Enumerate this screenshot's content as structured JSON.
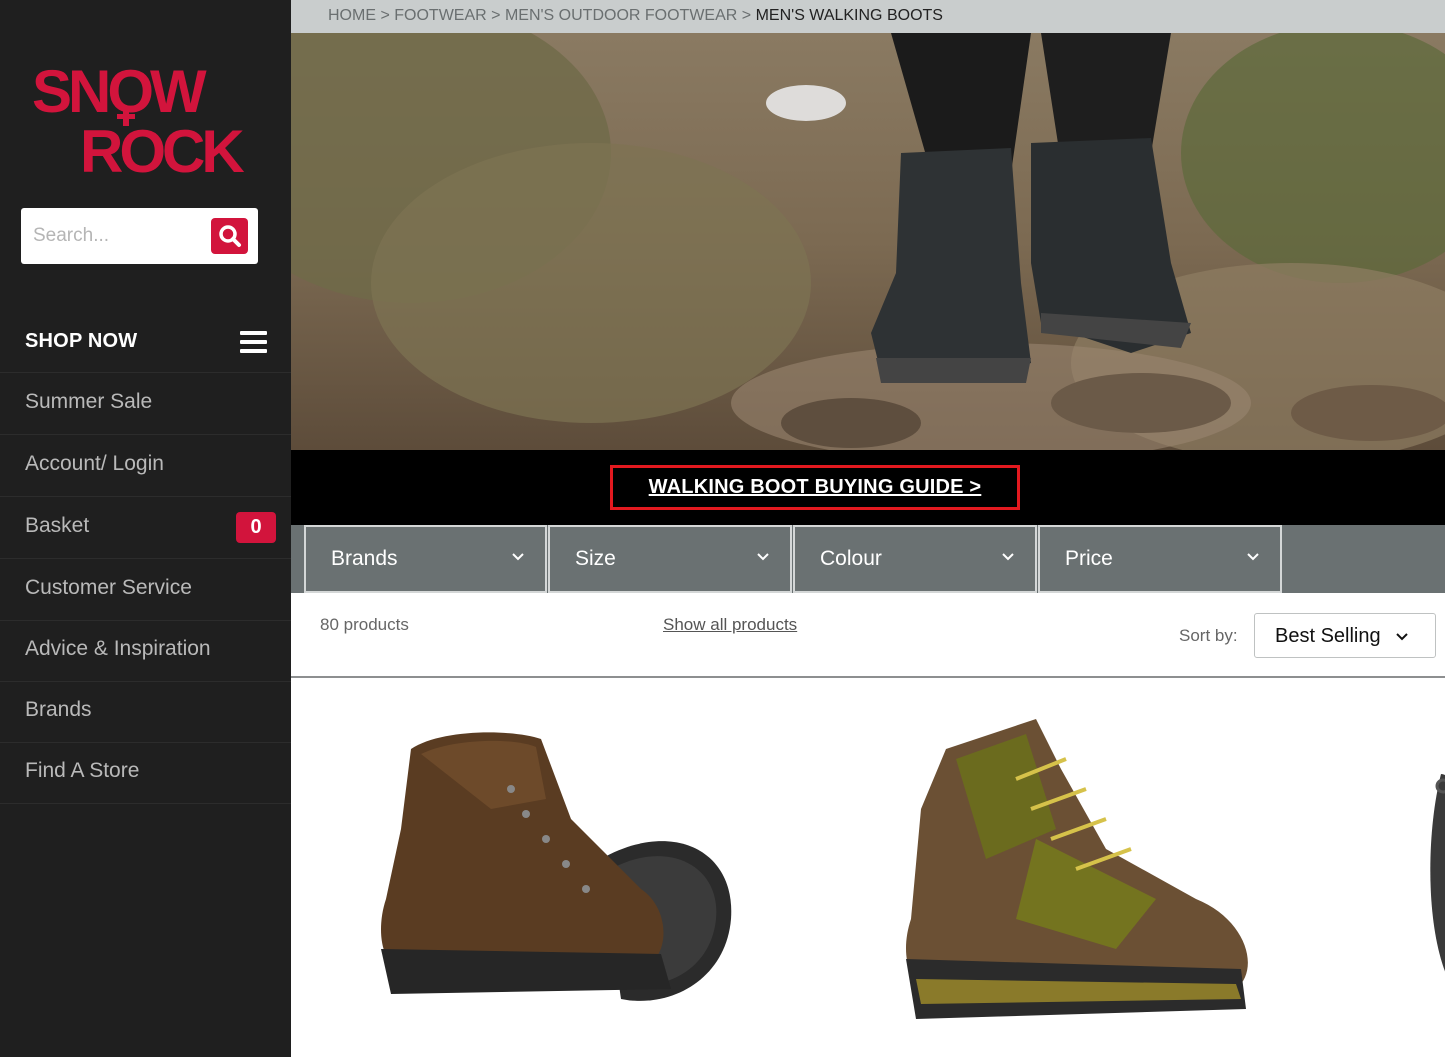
{
  "brand": {
    "logo_line1": "SNOW",
    "logo_line2": "ROCK",
    "colors": {
      "red": "#d2143c",
      "sidebar": "#1f1f1f",
      "filter": "#6a7172"
    }
  },
  "search": {
    "placeholder": "Search...",
    "icon": "search-icon"
  },
  "sidebar": {
    "shop_now": "SHOP NOW",
    "items": [
      {
        "label": "Summer Sale"
      },
      {
        "label": "Account/ Login"
      },
      {
        "label": "Basket",
        "badge": "0"
      },
      {
        "label": "Customer Service"
      },
      {
        "label": "Advice & Inspiration"
      },
      {
        "label": "Brands"
      },
      {
        "label": "Find A Store"
      }
    ]
  },
  "breadcrumb": {
    "home": "HOME",
    "sep": ">",
    "footwear": "FOOTWEAR",
    "outdoor": "MEN'S OUTDOOR FOOTWEAR",
    "current": "MEN'S WALKING BOOTS"
  },
  "guide": {
    "label": "WALKING BOOT BUYING GUIDE >"
  },
  "filters": [
    {
      "label": "Brands"
    },
    {
      "label": "Size"
    },
    {
      "label": "Colour"
    },
    {
      "label": "Price"
    }
  ],
  "results": {
    "count": "80 products",
    "show_all": "Show all products",
    "sort_label": "Sort by:",
    "sort_value": "Best Selling"
  }
}
